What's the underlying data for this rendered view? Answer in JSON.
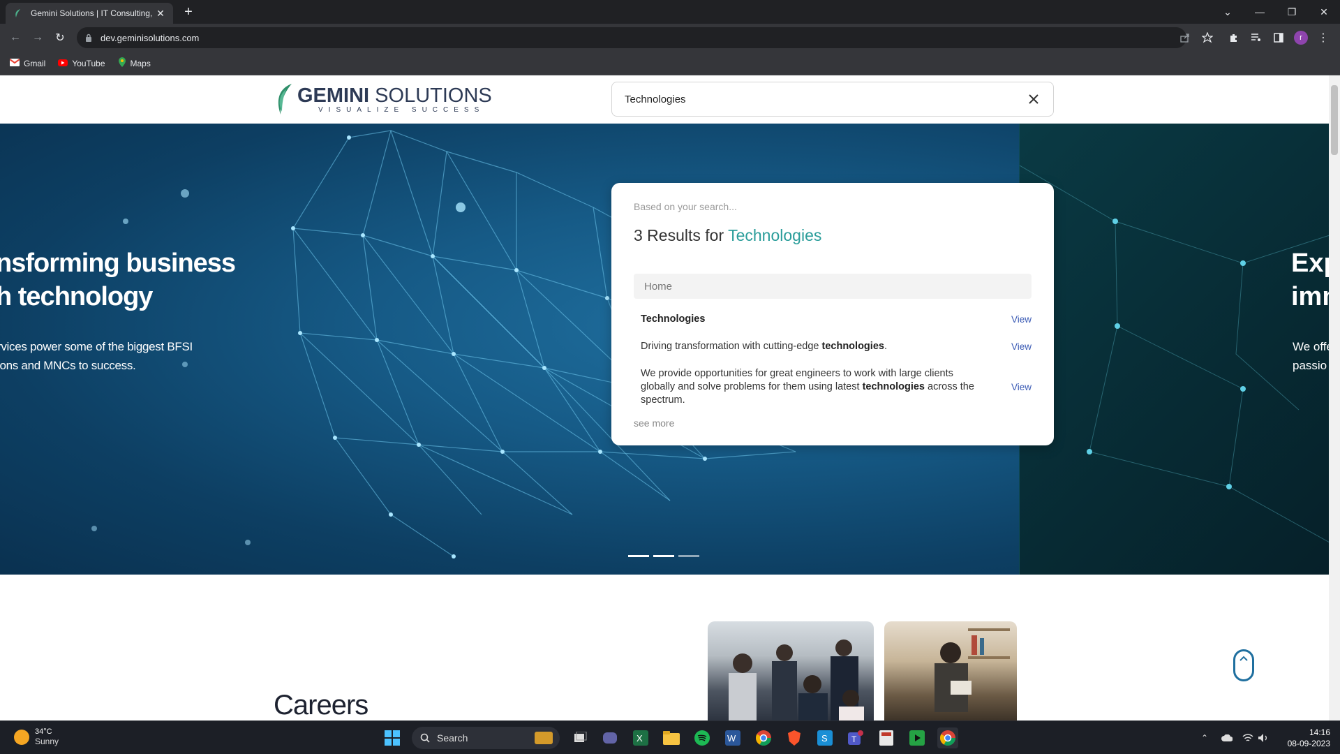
{
  "browser": {
    "tab_title": "Gemini Solutions | IT Consulting,",
    "url": "dev.geminisolutions.com",
    "bookmarks": [
      {
        "label": "Gmail",
        "icon": "gmail-icon"
      },
      {
        "label": "YouTube",
        "icon": "youtube-icon"
      },
      {
        "label": "Maps",
        "icon": "maps-icon"
      }
    ],
    "profile_initial": "r"
  },
  "site": {
    "logo_main_bold": "GEMINI",
    "logo_main_rest": " SOLUTIONS",
    "logo_tagline": "VISUALIZE SUCCESS"
  },
  "search": {
    "query": "Technologies",
    "based_on": "Based on your search...",
    "count_prefix": "3 Results for ",
    "term": "Technologies",
    "category": "Home",
    "results": [
      {
        "pre": "",
        "bold": "Technologies",
        "post": "",
        "view": "View"
      },
      {
        "pre": "Driving transformation with cutting-edge ",
        "bold": "technologies",
        "post": ".",
        "view": "View"
      },
      {
        "pre": "We provide opportunities for great engineers to work with large clients globally and solve problems for them using latest ",
        "bold": "technologies",
        "post": " across the spectrum.",
        "view": "View"
      }
    ],
    "see_more": "see more"
  },
  "hero": {
    "heading_line1": "nsforming business",
    "heading_line2": "h technology",
    "para_line1": "rvices power some of the biggest BFSI",
    "para_line2": "ions and MNCs to success.",
    "right_heading_line1": "Exp",
    "right_heading_line2": "imm",
    "right_para_line1": "We offe",
    "right_para_line2": "passio"
  },
  "careers": {
    "title": "Careers"
  },
  "taskbar": {
    "temperature": "34°C",
    "condition": "Sunny",
    "search_label": "Search",
    "time": "14:16",
    "date": "08-09-2023"
  },
  "colors": {
    "accent_teal": "#2a9d9a",
    "link_blue": "#3b5bb5",
    "hero_blue": "#165a86"
  }
}
